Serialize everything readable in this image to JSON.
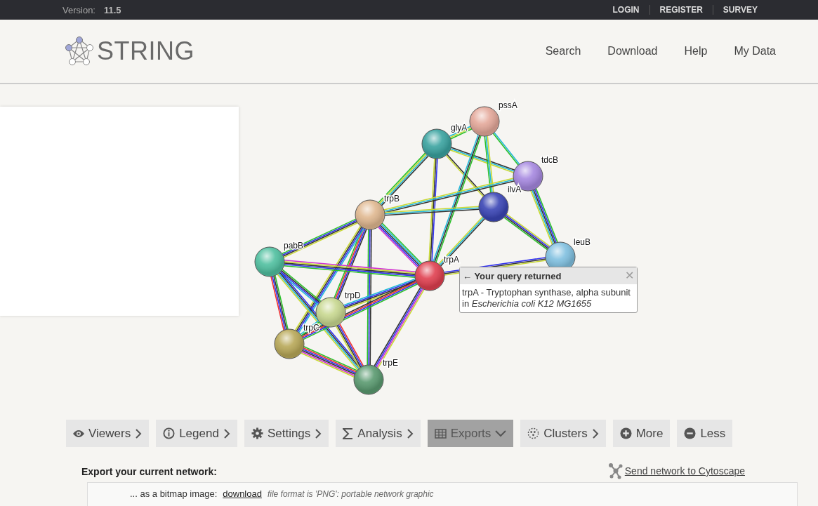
{
  "top_bar": {
    "version_label": "Version:",
    "version": "11.5",
    "links": [
      "LOGIN",
      "REGISTER",
      "SURVEY"
    ]
  },
  "header": {
    "logo": "STRING",
    "nav": [
      "Search",
      "Download",
      "Help",
      "My Data"
    ]
  },
  "network": {
    "nodes": [
      {
        "label": "pssA",
        "color": "#e4a89a"
      },
      {
        "label": "glyA",
        "color": "#3aa3a0"
      },
      {
        "label": "tdcB",
        "color": "#a688e0"
      },
      {
        "label": "ilvA",
        "color": "#3a45b5"
      },
      {
        "label": "trpB",
        "color": "#e0b890"
      },
      {
        "label": "leuB",
        "color": "#80c0e0"
      },
      {
        "label": "pabB",
        "color": "#50c0a0"
      },
      {
        "label": "trpA",
        "color": "#e04050"
      },
      {
        "label": "trpD",
        "color": "#c8d890"
      },
      {
        "label": "trpC",
        "color": "#b8a858"
      },
      {
        "label": "trpE",
        "color": "#5a9a70"
      }
    ],
    "tooltip": {
      "title": "← Your query returned",
      "close": "✕",
      "text": "trpA - Tryptophan synthase, alpha subunit in *Escherichia coli K12 MG1655*"
    }
  },
  "toolbar": [
    {
      "label": "Viewers",
      "kind": "menu",
      "selected": false
    },
    {
      "label": "Legend",
      "kind": "menu",
      "selected": false
    },
    {
      "label": "Settings",
      "kind": "menu",
      "selected": false
    },
    {
      "label": "Analysis",
      "kind": "menu",
      "selected": false
    },
    {
      "label": "Exports",
      "kind": "menu",
      "selected": true
    },
    {
      "label": "Clusters",
      "kind": "menu",
      "selected": false
    },
    {
      "label": "More",
      "kind": "action",
      "selected": false
    },
    {
      "label": "Less",
      "kind": "action",
      "selected": false
    }
  ],
  "export": {
    "heading": "Export your current network:",
    "cytoscape_link": "Send network to Cytoscape",
    "rows": [
      {
        "label": "... as a bitmap image:",
        "link": "download",
        "note": "file format is 'PNG': portable network graphic"
      }
    ]
  }
}
